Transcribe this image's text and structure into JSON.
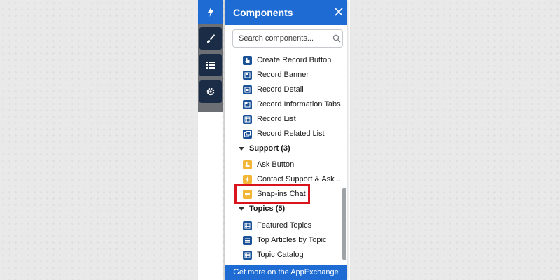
{
  "panel": {
    "title": "Components",
    "search": {
      "placeholder": "Search components...",
      "value": ""
    },
    "footer": "Get more on the AppExchange"
  },
  "items": [
    {
      "label": "Create Record Button",
      "icon": "hand-pointer-icon",
      "color": "#1b5297"
    },
    {
      "label": "Record Banner",
      "icon": "record-banner-icon",
      "color": "#1b5297"
    },
    {
      "label": "Record Detail",
      "icon": "record-detail-icon",
      "color": "#1b5297"
    },
    {
      "label": "Record Information Tabs",
      "icon": "tabs-icon",
      "color": "#1b5297"
    },
    {
      "label": "Record List",
      "icon": "grid-icon",
      "color": "#1b5297"
    },
    {
      "label": "Record Related List",
      "icon": "related-list-icon",
      "color": "#1b5297"
    }
  ],
  "sections": [
    {
      "label": "Support (3)"
    },
    {
      "label": "Topics (5)"
    }
  ],
  "support_items": [
    {
      "label": "Ask Button",
      "icon": "hand-pointer-icon",
      "color": "#f2b535"
    },
    {
      "label": "Contact Support & Ask ...",
      "icon": "lightning-icon",
      "color": "#f2b535"
    },
    {
      "label": "Snap-ins Chat",
      "icon": "chat-icon",
      "color": "#f2b535"
    }
  ],
  "topic_items": [
    {
      "label": "Featured Topics",
      "icon": "grid-icon",
      "color": "#1b5297"
    },
    {
      "label": "Top Articles by Topic",
      "icon": "list-icon",
      "color": "#1b5297"
    },
    {
      "label": "Topic Catalog",
      "icon": "grid-icon",
      "color": "#1b5297"
    }
  ],
  "colors": {
    "header": "#1e6cd3",
    "toolbar_button": "#1b2c46",
    "highlight": "#d9141c"
  }
}
